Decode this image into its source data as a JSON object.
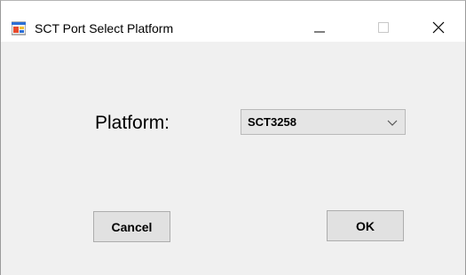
{
  "window": {
    "title": "SCT Port Select Platform",
    "icon": "windows-form-icon",
    "controls": {
      "minimize": "minimize-icon",
      "maximize": "maximize-icon",
      "close": "close-icon"
    }
  },
  "form": {
    "platform_label": "Platform:",
    "platform_value": "SCT3258",
    "cancel_label": "Cancel",
    "ok_label": "OK"
  },
  "colors": {
    "window_background": "#f0f0f0",
    "titlebar": "#ffffff",
    "button_face": "#e1e1e1",
    "combo_face": "#e5e5e5",
    "border": "#adadad"
  }
}
